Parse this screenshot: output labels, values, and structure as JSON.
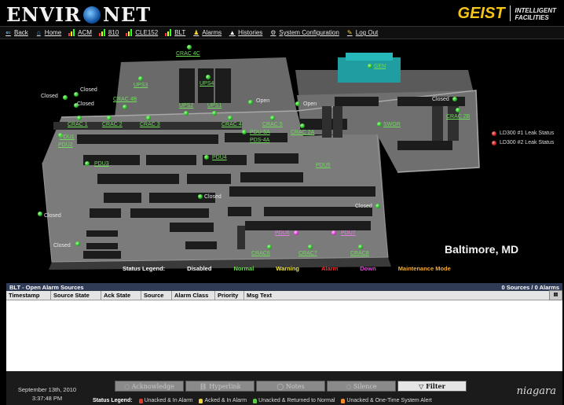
{
  "header": {
    "logo_left": "ENVIR",
    "logo_right": "NET",
    "brand": "GEIST",
    "brand_line1": "INTELLIGENT",
    "brand_line2": "FACILITIES"
  },
  "nav": [
    {
      "label": "Back",
      "icon": "back-arrow-icon"
    },
    {
      "label": "Home",
      "icon": "home-icon"
    },
    {
      "label": "ACM",
      "icon": "bar-chart-icon"
    },
    {
      "label": "810",
      "icon": "bar-chart-icon"
    },
    {
      "label": "CLE152",
      "icon": "bar-chart-icon"
    },
    {
      "label": "BLT",
      "icon": "bar-chart-icon"
    },
    {
      "label": "Alarms",
      "icon": "bell-icon"
    },
    {
      "label": "Histories",
      "icon": "histories-icon"
    },
    {
      "label": "System Configuration",
      "icon": "config-icon"
    },
    {
      "label": "Log Out",
      "icon": "logout-icon"
    }
  ],
  "map": {
    "units": [
      "CRAC 4C",
      "UPS3",
      "UPS4",
      "CRAC 4B",
      "UPS2",
      "UPS1",
      "CRAC 1",
      "CRAC 2",
      "CRAC 3",
      "CRAC 4",
      "CRAC 5",
      "PDU1",
      "PDU2",
      "PDU3",
      "PDU4",
      "PDU-5A",
      "PDS-4A",
      "CRAC 2A",
      "CRAC 2B",
      "SWGR",
      "GEN",
      "PDU5",
      "CRAC6",
      "CRAC7",
      "CRAC8"
    ],
    "magenta_units": [
      "PDU6",
      "PDU7"
    ],
    "states": {
      "closed": "Closed",
      "open": "Open"
    },
    "leaks": [
      "LD300 #1 Leak Status",
      "LD300 #2 Leak Status"
    ],
    "city": "Baltimore, MD"
  },
  "status_legend": {
    "title": "Status Legend:",
    "items": [
      {
        "label": "Disabled",
        "color": "#ffffff"
      },
      {
        "label": "Normal",
        "color": "#6fdc5a"
      },
      {
        "label": "Warning",
        "color": "#f5e63a"
      },
      {
        "label": "Alarm",
        "color": "#ff2b2b"
      },
      {
        "label": "Down",
        "color": "#e14ee0"
      },
      {
        "label": "Maintenance Mode",
        "color": "#f3a936"
      }
    ]
  },
  "alarm_panel": {
    "title": "BLT - Open Alarm Sources",
    "summary": "0 Sources / 0 Alarms",
    "columns": [
      "Timestamp",
      "Source State",
      "Ack State",
      "Source",
      "Alarm Class",
      "Priority",
      "Msg Text"
    ]
  },
  "footer": {
    "date": "September 13th, 2010",
    "time": "3:37:48 PM",
    "buttons": [
      "Acknowledge",
      "Hyperlink",
      "Notes",
      "Silence",
      "Filter"
    ],
    "legend_title": "Status Legend:",
    "legend": [
      {
        "label": "Unacked & In Alarm",
        "color": "#e23a2a"
      },
      {
        "label": "Acked & In Alarm",
        "color": "#f5d23a"
      },
      {
        "label": "Unacked & Returned to Normal",
        "color": "#5dc84a"
      },
      {
        "label": "Unacked & One-Time System Alert",
        "color": "#f08a2a"
      }
    ],
    "niagara": "niagara"
  }
}
